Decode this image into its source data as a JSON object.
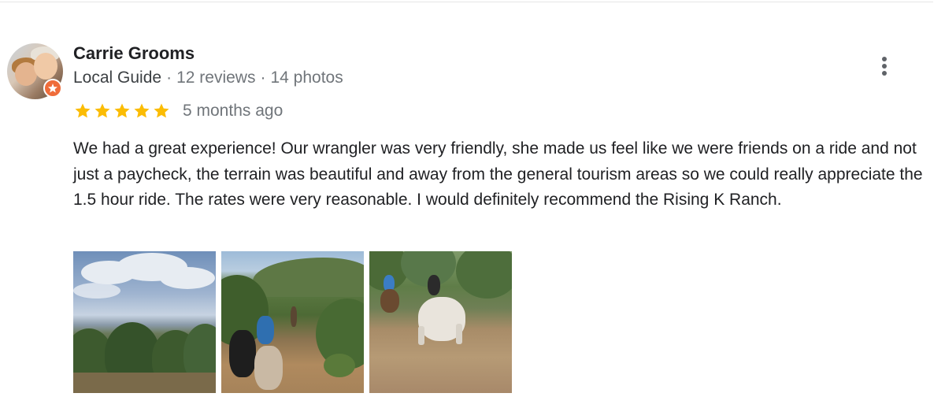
{
  "review": {
    "author_name": "Carrie Grooms",
    "author_badge": "Local Guide",
    "reviews_count": "12 reviews",
    "photos_count": "14 photos",
    "separator": "·",
    "rating": 5,
    "rating_max": 5,
    "time_ago": "5 months ago",
    "text": "We had a great experience! Our wrangler was very friendly, she made us feel like we were friends on a ride and not just a paycheck, the terrain was beautiful and away from the general tourism areas so we could really appreciate the 1.5 hour ride. The rates were very reasonable. I would definitely recommend the Rising K Ranch.",
    "photos": [
      {
        "name": "review-photo-1",
        "subject": "landscape-clouds-trees"
      },
      {
        "name": "review-photo-2",
        "subject": "trail-riders"
      },
      {
        "name": "review-photo-3",
        "subject": "horses-on-trail"
      }
    ]
  },
  "icons": {
    "more": "more-vert-icon",
    "star": "star-icon",
    "badge": "local-guide-badge-icon"
  },
  "colors": {
    "star": "#fbbc04",
    "badge": "#ef6c3a",
    "muted_text": "#70757a",
    "primary_text": "#202124"
  }
}
